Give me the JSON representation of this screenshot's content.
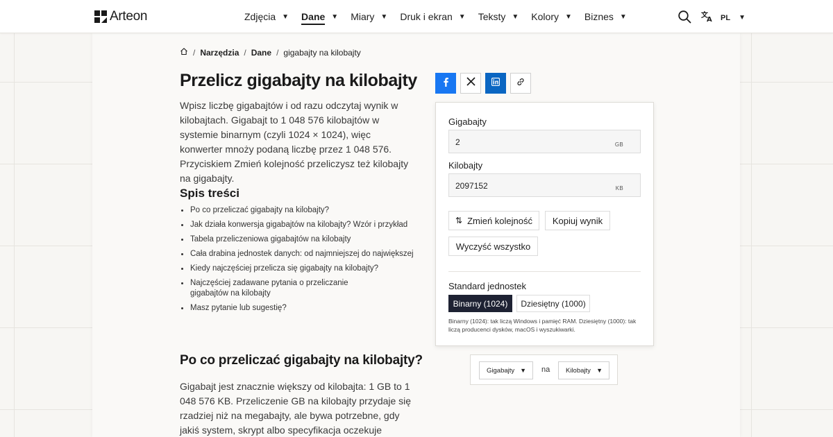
{
  "header": {
    "logo_text": "Arteon",
    "nav": [
      {
        "label": "Zdjęcia"
      },
      {
        "label": "Dane",
        "active": true
      },
      {
        "label": "Miary"
      },
      {
        "label": "Druk i ekran"
      },
      {
        "label": "Teksty"
      },
      {
        "label": "Kolory"
      },
      {
        "label": "Biznes"
      }
    ],
    "lang": "PL"
  },
  "breadcrumb": {
    "items": [
      "Narzędzia",
      "Dane",
      "gigabajty na kilobajty"
    ]
  },
  "article": {
    "title": "Przelicz gigabajty na kilobajty",
    "intro": "Wpisz liczbę gigabajtów i od razu odczytaj wynik w kilobajtach. Gigabajt to 1 048 576 kilobajtów w systemie binarnym (czyli 1024 × 1024), więc konwerter mnoży podaną liczbę przez 1 048 576. Przyciskiem Zmień kolejność przeliczysz też kilobajty na gigabajty.",
    "toc_title": "Spis treści",
    "toc": [
      "Po co przeliczać gigabajty na kilobajty?",
      "Jak działa konwersja gigabajtów na kilobajty? Wzór i przykład",
      "Tabela przeliczeniowa gigabajtów na kilobajty",
      "Cała drabina jednostek danych: od najmniejszej do największej",
      "Kiedy najczęściej przelicza się gigabajty na kilobajty?",
      "Najczęściej zadawane pytania o przeliczanie gigabajtów na kilobajty",
      "Masz pytanie lub sugestię?"
    ],
    "section_title": "Po co przeliczać gigabajty na kilobajty?",
    "section_text": "Gigabajt jest znacznie większy od kilobajta: 1 GB to 1 048 576 KB. Przeliczenie GB na kilobajty przydaje się rzadziej niż na megabajty, ale bywa potrzebne, gdy jakiś system, skrypt albo specyfikacja oczekuje wartości w kilobajtach, a"
  },
  "converter": {
    "from_label": "Gigabajty",
    "from_value": "2",
    "from_unit": "GB",
    "to_label": "Kilobajty",
    "to_value": "2097152",
    "to_unit": "KB",
    "swap_label": "Zmień kolejność",
    "copy_label": "Kopiuj wynik",
    "clear_label": "Wyczyść wszystko",
    "standard_label": "Standard jednostek",
    "std_binary": "Binarny (1024)",
    "std_decimal": "Dziesiętny (1000)",
    "std_selected": "binary",
    "std_note": "Binarny (1024): tak liczą Windows i pamięć RAM. Dziesiętny (1000): tak liczą producenci dysków, macOS i wyszukiwarki."
  },
  "unit_selector": {
    "from": "Gigabajty",
    "joiner": "na",
    "to": "Kilobajty"
  },
  "icons": {
    "logo": "arteon-logo-icon",
    "search": "search-icon",
    "translate": "translate-icon",
    "home": "home-icon",
    "share": [
      "facebook-icon",
      "x-icon",
      "linkedin-icon",
      "link-icon"
    ],
    "swap": "swap-arrows-icon"
  },
  "colors": {
    "facebook": "#1877f2",
    "linkedin": "#0a66c2",
    "segment_active": "#1e2233"
  }
}
